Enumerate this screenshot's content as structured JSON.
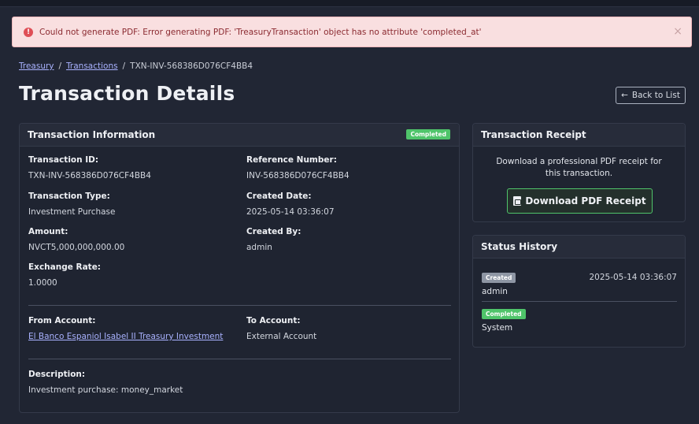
{
  "alert": {
    "message": "Could not generate PDF: Error generating PDF: 'TreasuryTransaction' object has no attribute 'completed_at'",
    "icon": "!",
    "close": "×",
    "color": "#df4e56"
  },
  "breadcrumb": {
    "items": [
      "Treasury",
      "Transactions"
    ],
    "current": "TXN-INV-568386D076CF4BB4",
    "separator": "/"
  },
  "header": {
    "title": "Transaction Details",
    "back_label": "Back to List",
    "back_icon": "←"
  },
  "info": {
    "title": "Transaction Information",
    "status_badge": "Completed",
    "transaction_id_label": "Transaction ID:",
    "transaction_id": "TXN-INV-568386D076CF4BB4",
    "reference_label": "Reference Number:",
    "reference": "INV-568386D076CF4BB4",
    "type_label": "Transaction Type:",
    "type": "Investment Purchase",
    "created_date_label": "Created Date:",
    "created_date": "2025-05-14 03:36:07",
    "amount_label": "Amount:",
    "amount": "NVCT5,000,000,000.00",
    "created_by_label": "Created By:",
    "created_by": "admin",
    "exchange_label": "Exchange Rate:",
    "exchange": "1.0000",
    "from_label": "From Account:",
    "from": "El Banco Espaniol Isabel II Treasury Investment",
    "to_label": "To Account:",
    "to": "External Account",
    "description_label": "Description:",
    "description": "Investment purchase: money_market"
  },
  "receipt": {
    "title": "Transaction Receipt",
    "text": "Download a professional PDF receipt for this transaction.",
    "button_label": "Download PDF Receipt"
  },
  "status_history": {
    "title": "Status History",
    "items": [
      {
        "status": "Created",
        "user": "admin",
        "time": "2025-05-14 03:36:07"
      },
      {
        "status": "Completed",
        "user": "System",
        "time": ""
      }
    ]
  },
  "colors": {
    "accent_link": "#a9b2ff",
    "completed": "#4fc46a",
    "created": "#8e96a4",
    "background": "#212634"
  }
}
